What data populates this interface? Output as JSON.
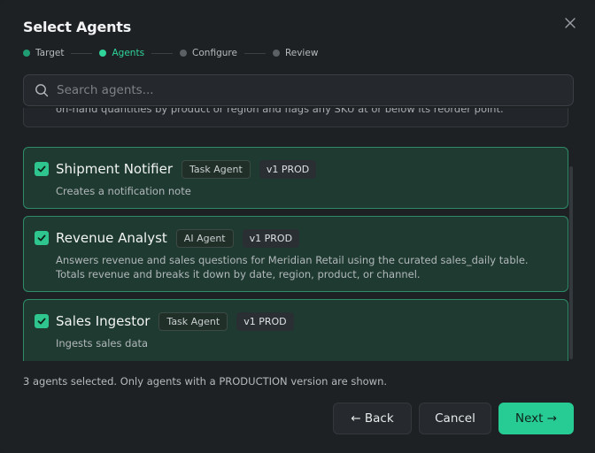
{
  "dialog": {
    "title": "Select Agents",
    "close_icon": "close-icon"
  },
  "stepper": {
    "steps": [
      {
        "label": "Target",
        "state": "done"
      },
      {
        "label": "Agents",
        "state": "active"
      },
      {
        "label": "Configure",
        "state": "pending"
      },
      {
        "label": "Review",
        "state": "pending"
      }
    ]
  },
  "search": {
    "placeholder": "Search agents...",
    "value": "",
    "icon": "search-icon"
  },
  "agents": {
    "partial_text": "on-hand quantities by product or region and flags any SKU at or below its reorder point.",
    "items": [
      {
        "name": "Shipment Notifier",
        "type": "Task Agent",
        "version": "v1 PROD",
        "checked": true,
        "description": [
          "Creates a notification note"
        ]
      },
      {
        "name": "Revenue Analyst",
        "type": "AI Agent",
        "version": "v1 PROD",
        "checked": true,
        "description": [
          "Answers revenue and sales questions for Meridian Retail using the curated sales_daily table.",
          "Totals revenue and breaks it down by date, region, product, or channel."
        ]
      },
      {
        "name": "Sales Ingestor",
        "type": "Task Agent",
        "version": "v1 PROD",
        "checked": true,
        "description": [
          "Ingests sales data"
        ]
      }
    ]
  },
  "footer": {
    "status": "3 agents selected. Only agents with a PRODUCTION version are shown.",
    "back_label": "← Back",
    "cancel_label": "Cancel",
    "next_label": "Next →"
  },
  "colors": {
    "accent": "#26cc93",
    "card_bg": "#1f3a31",
    "card_border": "#2f8a68",
    "background": "#1e2124"
  }
}
